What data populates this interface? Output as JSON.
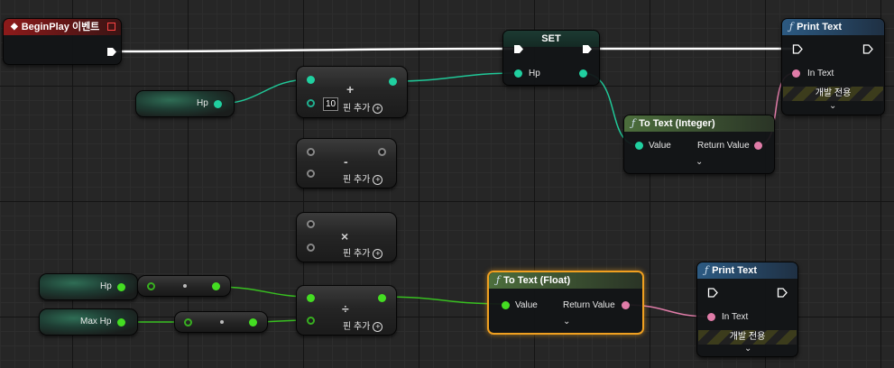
{
  "begin_play": {
    "title": "BeginPlay 이벤트"
  },
  "set_node": {
    "title": "SET",
    "pin": "Hp"
  },
  "print_text_top": {
    "title": "Print Text",
    "in_pin": "In Text",
    "dev_only": "개발 전용"
  },
  "print_text_bottom": {
    "title": "Print Text",
    "in_pin": "In Text",
    "dev_only": "개발 전용"
  },
  "to_text_integer": {
    "title": "To Text (Integer)",
    "in_pin": "Value",
    "out_pin": "Return Value"
  },
  "to_text_float": {
    "title": "To Text (Float)",
    "in_pin": "Value",
    "out_pin": "Return Value"
  },
  "vars": {
    "hp_top": "Hp",
    "hp_bottom": "Hp",
    "max_hp": "Max Hp"
  },
  "math": {
    "add_symbol": "+",
    "add_value": "10",
    "sub_symbol": "-",
    "mul_symbol": "×",
    "div_symbol": "÷",
    "add_pin_label": "핀 추가"
  },
  "icons": {
    "function": "function-f-icon",
    "event": "event-diamond-icon",
    "exec": "exec-arrow-icon",
    "expand": "chevron-down-icon",
    "add": "plus-circle-icon"
  },
  "colors": {
    "event_header": "#8d1a1a",
    "function_header": "#2c5a82",
    "conversion_header": "#4c6e3c",
    "int_pin": "#20d0a0",
    "float_pin": "#44dd22",
    "text_pin": "#e07ca8",
    "exec_pin": "#ffffff",
    "selection": "#f0a020"
  }
}
